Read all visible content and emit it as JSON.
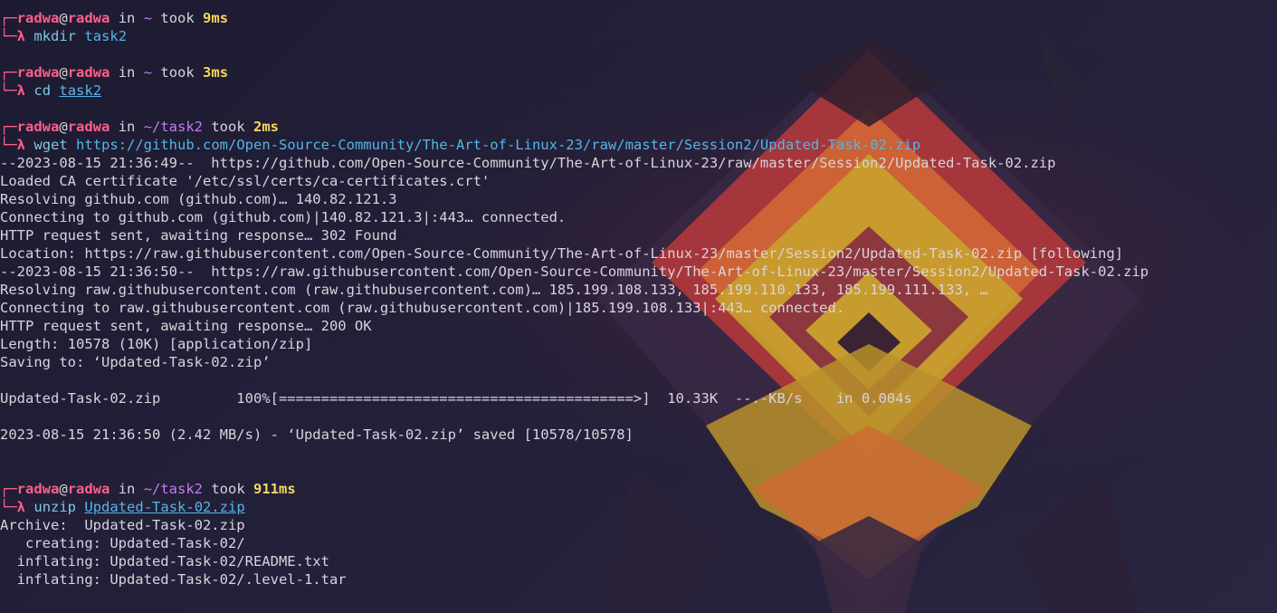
{
  "colors": {
    "prompt_user": "#ff5f8a",
    "prompt_dir": "#c57cf0",
    "prompt_duration": "#f5d75a",
    "command": "#7ec8e3",
    "argument": "#55b5e8",
    "output": "#d8d4dc",
    "background": "#1d1b31"
  },
  "prompt": {
    "corner_top": "┌─",
    "corner_bottom": "└─",
    "lambda": "λ",
    "user": "radwa",
    "at": "@",
    "host": "radwa",
    "in": " in ",
    "took": " took "
  },
  "blocks": [
    {
      "dir": "~",
      "duration": "9ms",
      "command": "mkdir",
      "argument": "task2",
      "argument_underlined": false,
      "output": [
        ""
      ]
    },
    {
      "dir": "~",
      "duration": "3ms",
      "command": "cd",
      "argument": "task2",
      "argument_underlined": true,
      "output": [
        ""
      ]
    },
    {
      "dir": "~/task2",
      "duration": "2ms",
      "command": "wget",
      "argument": "https://github.com/Open-Source-Community/The-Art-of-Linux-23/raw/master/Session2/Updated-Task-02.zip",
      "argument_underlined": false,
      "output": [
        "--2023-08-15 21:36:49--  https://github.com/Open-Source-Community/The-Art-of-Linux-23/raw/master/Session2/Updated-Task-02.zip",
        "Loaded CA certificate '/etc/ssl/certs/ca-certificates.crt'",
        "Resolving github.com (github.com)… 140.82.121.3",
        "Connecting to github.com (github.com)|140.82.121.3|:443… connected.",
        "HTTP request sent, awaiting response… 302 Found",
        "Location: https://raw.githubusercontent.com/Open-Source-Community/The-Art-of-Linux-23/master/Session2/Updated-Task-02.zip [following]",
        "--2023-08-15 21:36:50--  https://raw.githubusercontent.com/Open-Source-Community/The-Art-of-Linux-23/master/Session2/Updated-Task-02.zip",
        "Resolving raw.githubusercontent.com (raw.githubusercontent.com)… 185.199.108.133, 185.199.110.133, 185.199.111.133, …",
        "Connecting to raw.githubusercontent.com (raw.githubusercontent.com)|185.199.108.133|:443… connected.",
        "HTTP request sent, awaiting response… 200 OK",
        "Length: 10578 (10K) [application/zip]",
        "Saving to: ‘Updated-Task-02.zip’",
        "",
        "Updated-Task-02.zip         100%[==========================================>]  10.33K  --.-KB/s    in 0.004s",
        "",
        "2023-08-15 21:36:50 (2.42 MB/s) - ‘Updated-Task-02.zip’ saved [10578/10578]",
        "",
        ""
      ]
    },
    {
      "dir": "~/task2",
      "duration": "911ms",
      "command": "unzip",
      "argument": "Updated-Task-02.zip",
      "argument_underlined": true,
      "output": [
        "Archive:  Updated-Task-02.zip",
        "   creating: Updated-Task-02/",
        "  inflating: Updated-Task-02/README.txt",
        "  inflating: Updated-Task-02/.level-1.tar",
        ""
      ]
    }
  ]
}
